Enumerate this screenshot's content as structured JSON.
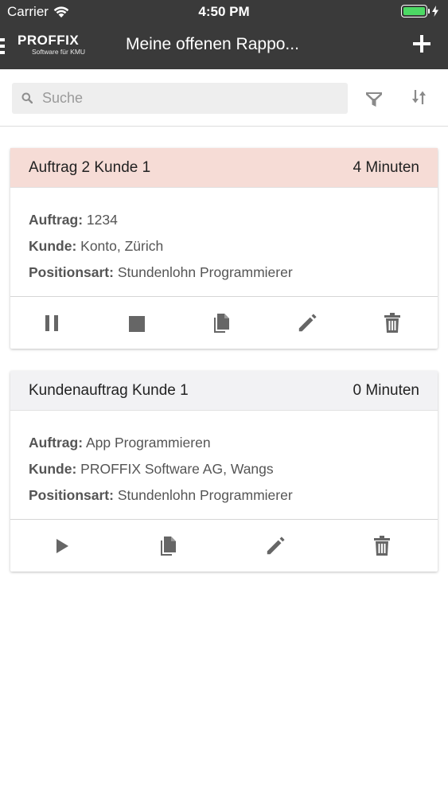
{
  "status_bar": {
    "carrier": "Carrier",
    "time": "4:50 PM"
  },
  "nav": {
    "logo_main": "PROFFIX",
    "logo_sub": "Software für KMU",
    "title": "Meine offenen Rappo..."
  },
  "search": {
    "placeholder": "Suche"
  },
  "cards": [
    {
      "title": "Auftrag 2 Kunde 1",
      "duration": "4 Minuten",
      "fields": [
        {
          "label": "Auftrag:",
          "value": "1234"
        },
        {
          "label": "Kunde:",
          "value": "Konto, Zürich"
        },
        {
          "label": "Positionsart:",
          "value": "Stundenlohn Programmierer"
        }
      ]
    },
    {
      "title": "Kundenauftrag Kunde 1",
      "duration": "0 Minuten",
      "fields": [
        {
          "label": "Auftrag:",
          "value": "App Programmieren"
        },
        {
          "label": "Kunde:",
          "value": "PROFFIX Software AG, Wangs"
        },
        {
          "label": "Positionsart:",
          "value": "Stundenlohn Programmierer"
        }
      ]
    }
  ],
  "colors": {
    "topbar": "#3a3a3a",
    "active_header": "#f6dcd6",
    "idle_header": "#f2f2f4",
    "icon": "#666666",
    "battery": "#4cd964"
  },
  "icons": [
    "wifi-icon",
    "battery-icon",
    "menu-icon",
    "add-icon",
    "search-icon",
    "filter-icon",
    "sort-icon",
    "pause-icon",
    "stop-icon",
    "copy-icon",
    "edit-icon",
    "delete-icon",
    "play-icon"
  ]
}
